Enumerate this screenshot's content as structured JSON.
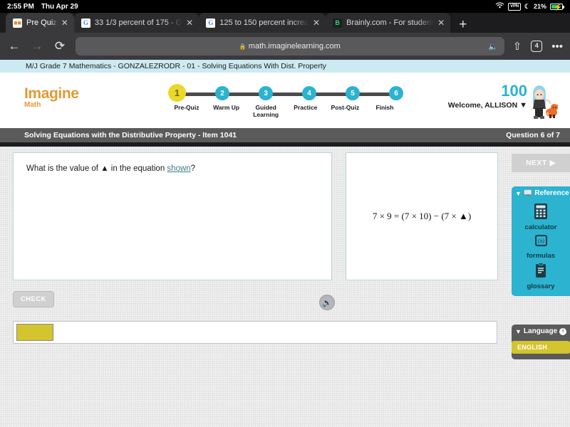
{
  "status_bar": {
    "time": "2:55 PM",
    "date": "Thu Apr 29",
    "wifi_icon": "wifi-icon",
    "vpn_label": "VPN",
    "dnd_icon": "moon-icon",
    "battery_percent": "21%",
    "battery_charging": true
  },
  "browser": {
    "tabs": [
      {
        "title": "Pre Quiz",
        "favicon": "imagine-learning-icon",
        "active": true,
        "close_label": "✕"
      },
      {
        "title": "33 1/3 percent of 175 - G",
        "favicon": "google-icon",
        "active": false,
        "close_label": "✕"
      },
      {
        "title": "125 to 150 percent increa",
        "favicon": "google-icon",
        "active": false,
        "close_label": "✕"
      },
      {
        "title": "Brainly.com - For student",
        "favicon": "brainly-icon",
        "active": false,
        "close_label": "✕"
      }
    ],
    "new_tab_label": "+",
    "back_icon": "←",
    "forward_icon": "→",
    "reload_icon": "⟳",
    "url": "math.imaginelearning.com",
    "lock_icon": "🔒",
    "mic_icon": "🎙",
    "share_icon": "⇧",
    "tab_count": "4",
    "more_icon": "•••"
  },
  "course_bar": {
    "text": "M/J Grade 7 Mathematics - GONZALEZRODR - 01 - Solving Equations With Dist. Property"
  },
  "header": {
    "logo_primary": "Imagine",
    "logo_secondary": "Math",
    "score": "100",
    "welcome": "Welcome, ALLISON",
    "welcome_caret": "▼",
    "avatar_name": "student-avatar",
    "steps": [
      {
        "number": "1",
        "label": "Pre-Quiz",
        "current": true
      },
      {
        "number": "2",
        "label": "Warm Up",
        "current": false
      },
      {
        "number": "3",
        "label": "Guided Learning",
        "current": false
      },
      {
        "number": "4",
        "label": "Practice",
        "current": false
      },
      {
        "number": "5",
        "label": "Post-Quiz",
        "current": false
      },
      {
        "number": "6",
        "label": "Finish",
        "current": false
      }
    ]
  },
  "item_bar": {
    "title": "Solving Equations with the Distributive Property - Item 1041",
    "question_counter": "Question 6 of 7"
  },
  "question": {
    "prompt_before": "What is the value of ▲ in the equation ",
    "prompt_link": "shown",
    "prompt_after": "?",
    "speaker_icon": "speaker-icon",
    "equation": "7 × 9 = (7 × 10) − (7 × ▲)"
  },
  "controls": {
    "check_label": "CHECK",
    "answer_value": "",
    "next_label": "NEXT",
    "next_icon": "▶"
  },
  "reference_panel": {
    "collapse_icon": "▼",
    "header_icon": "book-icon",
    "title": "Reference",
    "tools": [
      {
        "name": "calculator",
        "icon": "calculator-icon",
        "glyph": "🖫"
      },
      {
        "name": "formulas",
        "icon": "formulas-icon",
        "glyph": "ƒx"
      },
      {
        "name": "glossary",
        "icon": "glossary-icon",
        "glyph": "📋"
      }
    ]
  },
  "language_panel": {
    "collapse_icon": "▼",
    "title": "Language",
    "info_icon": "i",
    "selected_language": "ENGLISH"
  }
}
